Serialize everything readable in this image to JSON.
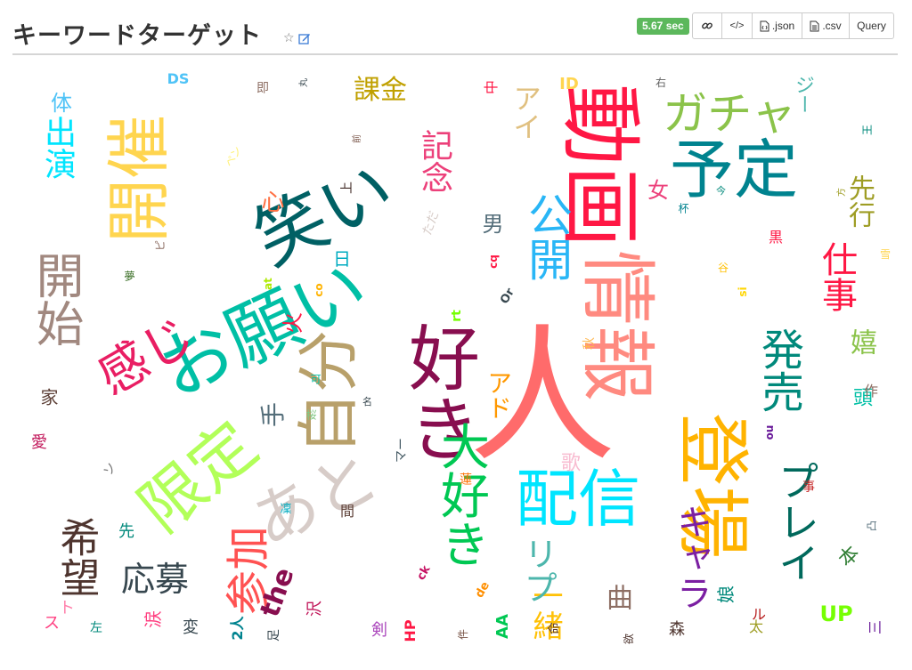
{
  "header": {
    "title": "キーワードターゲット",
    "star_icon": "☆",
    "time_badge": "5.67 sec",
    "buttons": {
      "link": "link-icon",
      "embed": "</>",
      "json": ".json",
      "csv": ".csv",
      "query": "Query"
    }
  },
  "cloud": {
    "words": [
      "人",
      "動画",
      "予定",
      "情報",
      "登場",
      "好き",
      "笑い",
      "お願い",
      "自分",
      "配信",
      "開催",
      "開始",
      "限定",
      "感じ",
      "大好き",
      "あと",
      "ガチャ",
      "発売",
      "プレイ",
      "希望",
      "出演",
      "記念",
      "公開",
      "仕事",
      "応募",
      "先行",
      "課金",
      "アイ",
      "一緒",
      "参加",
      "男",
      "曲",
      "アド",
      "リプ",
      "キャラ",
      "ジー",
      "女",
      "手",
      "心",
      "嬉",
      "本",
      "ID",
      "DS",
      "the",
      "UP",
      "AA",
      "HP",
      "2人",
      "at",
      "co",
      "cq",
      "de",
      "ck",
      "rt",
      "si",
      "Or",
      "ou",
      "即",
      "前",
      "上",
      "頭",
      "歌",
      "事",
      "愛",
      "作",
      "変",
      "剣",
      "先",
      "凜",
      "間",
      "森",
      "娘",
      "太",
      "三",
      "王",
      "凸",
      "名",
      "桜",
      "可",
      "今",
      "杯",
      "足",
      "欲",
      "件",
      "蓮",
      "命",
      "丸",
      "右",
      "方",
      "中",
      "夢",
      "秋",
      "谷",
      "日",
      "家",
      "左",
      "涙",
      "火",
      "沢",
      "体",
      "黒",
      "雪",
      "ただ",
      "マー",
      "ペン",
      "ピ",
      "ス",
      "ト",
      "ル",
      "ソ"
    ]
  }
}
